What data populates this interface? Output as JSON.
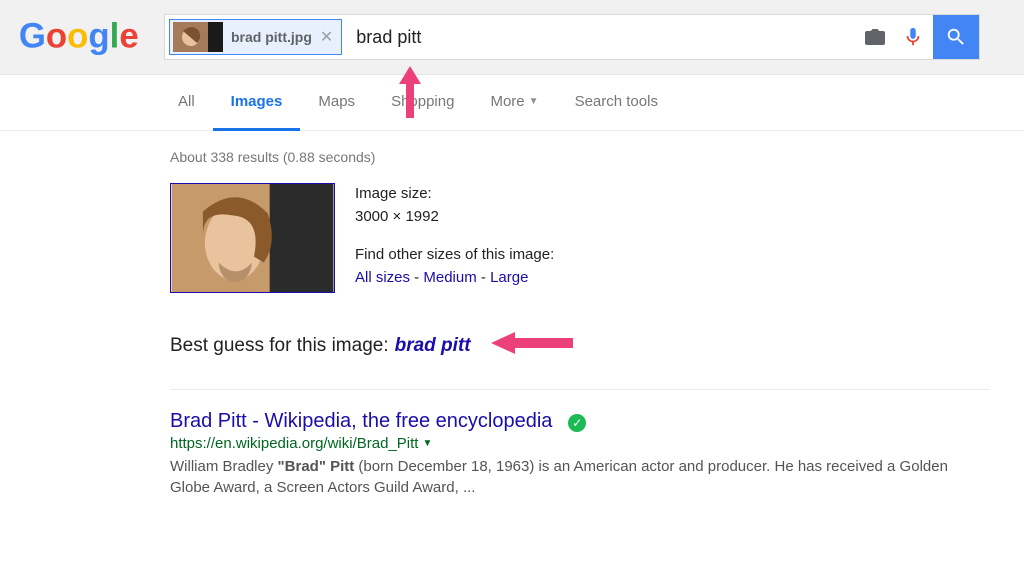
{
  "logo_letters": [
    "G",
    "o",
    "o",
    "g",
    "l",
    "e"
  ],
  "logo_colors": [
    "#4285f4",
    "#ea4335",
    "#fbbc05",
    "#4285f4",
    "#34a853",
    "#ea4335"
  ],
  "chip": {
    "filename": "brad pitt.jpg"
  },
  "search": {
    "query_value": "brad pitt"
  },
  "tabs": {
    "all": "All",
    "images": "Images",
    "maps": "Maps",
    "shopping": "Shopping",
    "more": "More",
    "tools": "Search tools"
  },
  "stats": "About 338 results (0.88 seconds)",
  "image_meta": {
    "size_label": "Image size:",
    "size_value": "3000 × 1992",
    "other_label": "Find other sizes of this image:",
    "link_all": "All sizes",
    "link_med": "Medium",
    "link_large": "Large",
    "sep": " - "
  },
  "bestguess": {
    "label": "Best guess for this image:",
    "value": "brad pitt"
  },
  "result1": {
    "title": "Brad Pitt - Wikipedia, the free encyclopedia",
    "url": "https://en.wikipedia.org/wiki/Brad_Pitt",
    "snippet_pre": "William Bradley ",
    "snippet_bold": "\"Brad\" Pitt",
    "snippet_post": " (born December 18, 1963) is an American actor and producer. He has received a Golden Globe Award, a Screen Actors Guild Award, ..."
  }
}
